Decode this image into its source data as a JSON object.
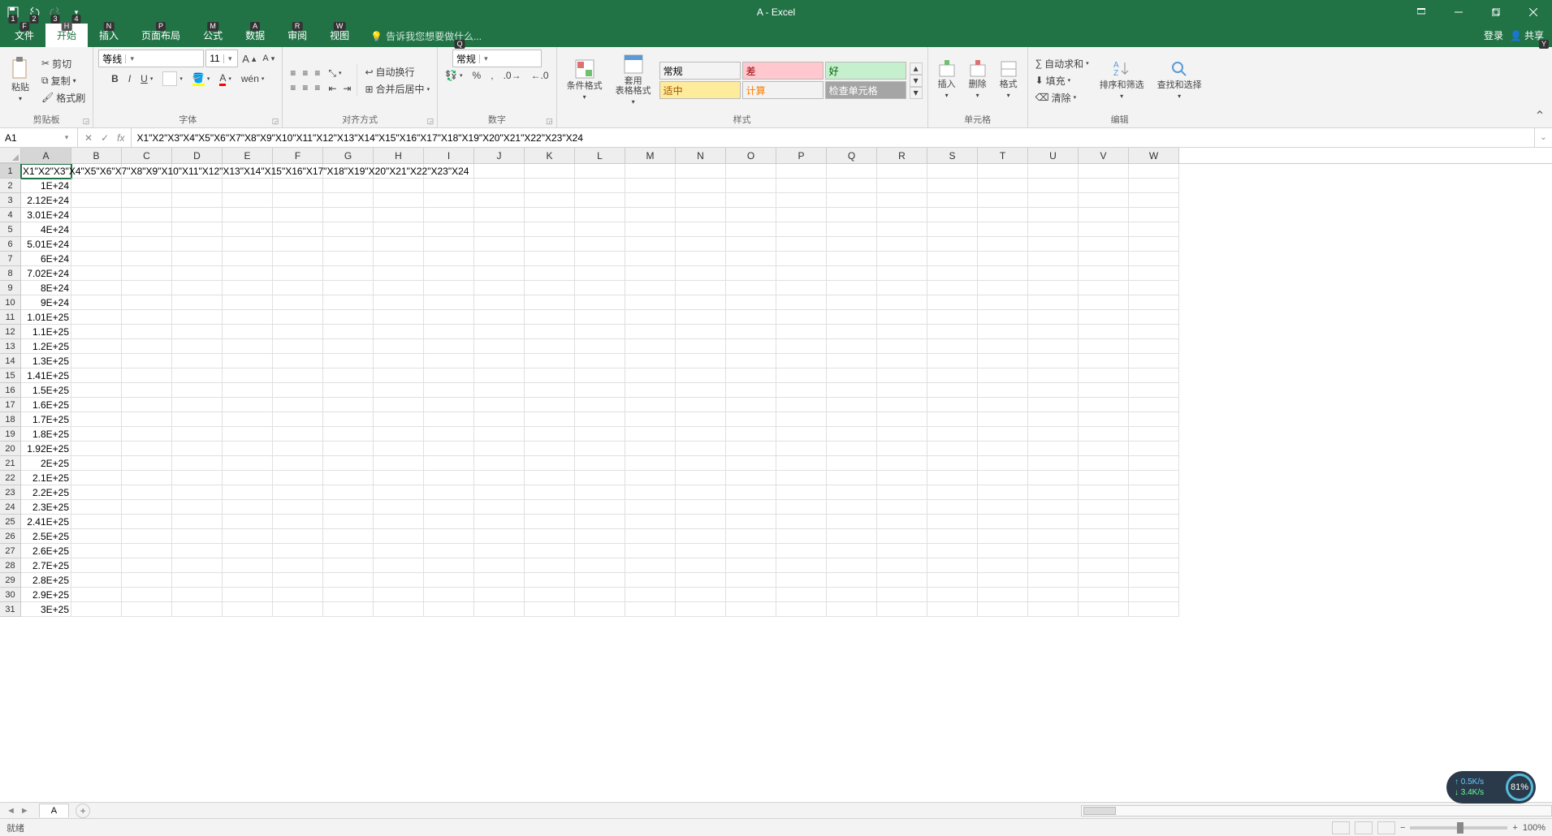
{
  "title": "A - Excel",
  "qat_nums": [
    "1",
    "2",
    "3",
    "4"
  ],
  "tabs": {
    "file": "文件",
    "home": "开始",
    "insert": "插入",
    "layout": "页面布局",
    "formula": "公式",
    "data": "数据",
    "review": "审阅",
    "view": "视图"
  },
  "tab_keys": {
    "file": "F",
    "home": "H",
    "insert": "N",
    "layout": "P",
    "formula": "M",
    "data": "A",
    "review": "R",
    "view": "W",
    "tellme": "Q",
    "share": "Y"
  },
  "tellme": "告诉我您想要做什么...",
  "login": "登录",
  "share": "共享",
  "ribbon": {
    "clipboard": {
      "paste": "粘贴",
      "cut": "剪切",
      "copy": "复制",
      "painter": "格式刷",
      "label": "剪贴板"
    },
    "font": {
      "name": "等线",
      "size": "11",
      "label": "字体"
    },
    "align": {
      "wrap": "自动换行",
      "merge": "合并后居中",
      "label": "对齐方式"
    },
    "number": {
      "format": "常规",
      "label": "数字"
    },
    "styles": {
      "cond": "条件格式",
      "table": "套用\n表格格式",
      "s_normal": "常规",
      "s_bad": "差",
      "s_good": "好",
      "s_neutral": "适中",
      "s_calc": "计算",
      "s_check": "检查单元格",
      "label": "样式"
    },
    "cells": {
      "insert": "插入",
      "delete": "删除",
      "format": "格式",
      "label": "单元格"
    },
    "editing": {
      "sum": "自动求和",
      "fill": "填充",
      "clear": "清除",
      "sort": "排序和筛选",
      "find": "查找和选择",
      "label": "编辑"
    }
  },
  "namebox": "A1",
  "formula": "X1\"X2\"X3\"X4\"X5\"X6\"X7\"X8\"X9\"X10\"X11\"X12\"X13\"X14\"X15\"X16\"X17\"X18\"X19\"X20\"X21\"X22\"X23\"X24",
  "columns": [
    "A",
    "B",
    "C",
    "D",
    "E",
    "F",
    "G",
    "H",
    "I",
    "J",
    "K",
    "L",
    "M",
    "N",
    "O",
    "P",
    "Q",
    "R",
    "S",
    "T",
    "U",
    "V",
    "W"
  ],
  "a1_display": "X1\"X2\"X3\"",
  "a1_overflow": "X1\"X2\"X3\"X4\"X5\"X6\"X7\"X8\"X9\"X10\"X11\"X12\"X13\"X14\"X15\"X16\"X17\"X18\"X19\"X20\"X21\"X22\"X23\"X24",
  "colA_values": [
    "",
    "1E+24",
    "2.12E+24",
    "3.01E+24",
    "4E+24",
    "5.01E+24",
    "6E+24",
    "7.02E+24",
    "8E+24",
    "9E+24",
    "1.01E+25",
    "1.1E+25",
    "1.2E+25",
    "1.3E+25",
    "1.41E+25",
    "1.5E+25",
    "1.6E+25",
    "1.7E+25",
    "1.8E+25",
    "1.92E+25",
    "2E+25",
    "2.1E+25",
    "2.2E+25",
    "2.3E+25",
    "2.41E+25",
    "2.5E+25",
    "2.6E+25",
    "2.7E+25",
    "2.8E+25",
    "2.9E+25",
    "3E+25"
  ],
  "row_count": 31,
  "sheet_tab": "A",
  "status": "就绪",
  "zoom": "100%",
  "net": {
    "up": "0.5K/s",
    "down": "3.4K/s",
    "pct": "81%"
  }
}
